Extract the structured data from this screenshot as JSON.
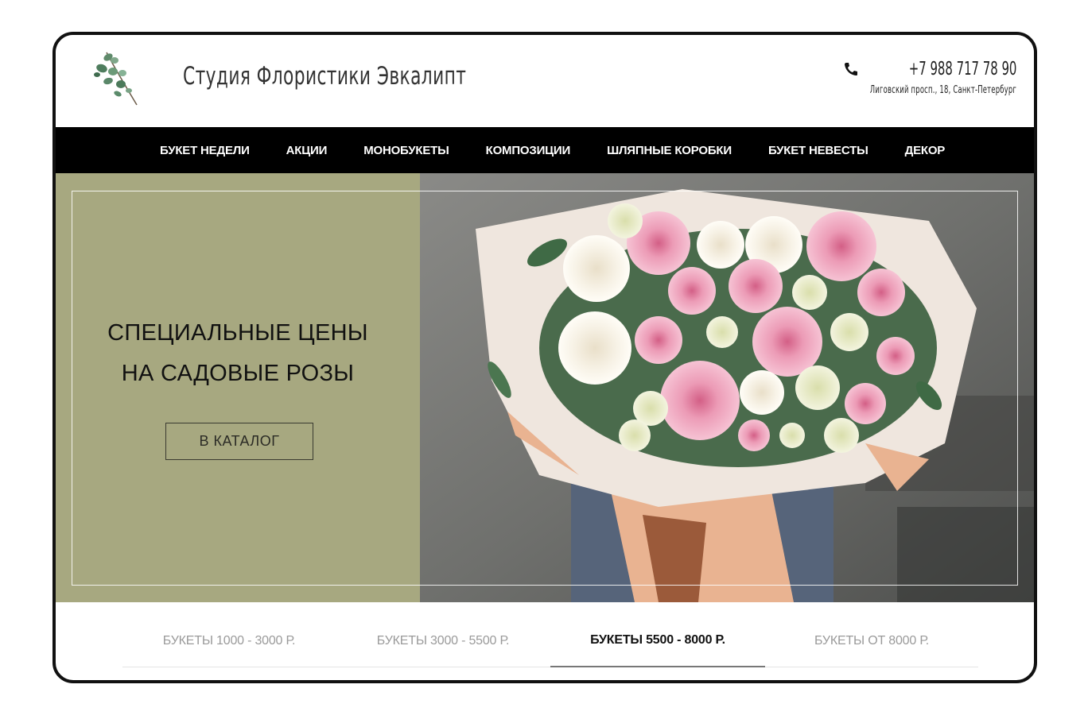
{
  "header": {
    "brand": "Студия Флористики Эвкалипт",
    "phone": "+7 988 717 78 90",
    "address": "Лиговский просп., 18, Санкт-Петербург"
  },
  "nav": {
    "items": [
      {
        "label": "БУКЕТ НЕДЕЛИ"
      },
      {
        "label": "АКЦИИ"
      },
      {
        "label": "МОНОБУКЕТЫ"
      },
      {
        "label": "КОМПОЗИЦИИ"
      },
      {
        "label": "ШЛЯПНЫЕ КОРОБКИ"
      },
      {
        "label": "БУКЕТ НЕВЕСТЫ"
      },
      {
        "label": "ДЕКОР"
      }
    ]
  },
  "hero": {
    "title_line1": "СПЕЦИАЛЬНЫЕ ЦЕНЫ",
    "title_line2": "НА САДОВЫЕ РОЗЫ",
    "button_label": "В КАТАЛОГ"
  },
  "tabs": {
    "items": [
      {
        "label": "БУКЕТЫ 1000 - 3000 Р."
      },
      {
        "label": "БУКЕТЫ 3000 - 5500 Р."
      },
      {
        "label": "БУКЕТЫ 5500 - 8000 Р."
      },
      {
        "label": "БУКЕТЫ ОТ 8000 Р."
      }
    ],
    "active_index": 2
  },
  "colors": {
    "accent_olive": "#a7a880",
    "nav_bg": "#000000"
  },
  "icons": [
    "eucalyptus-logo-icon",
    "phone-icon"
  ]
}
